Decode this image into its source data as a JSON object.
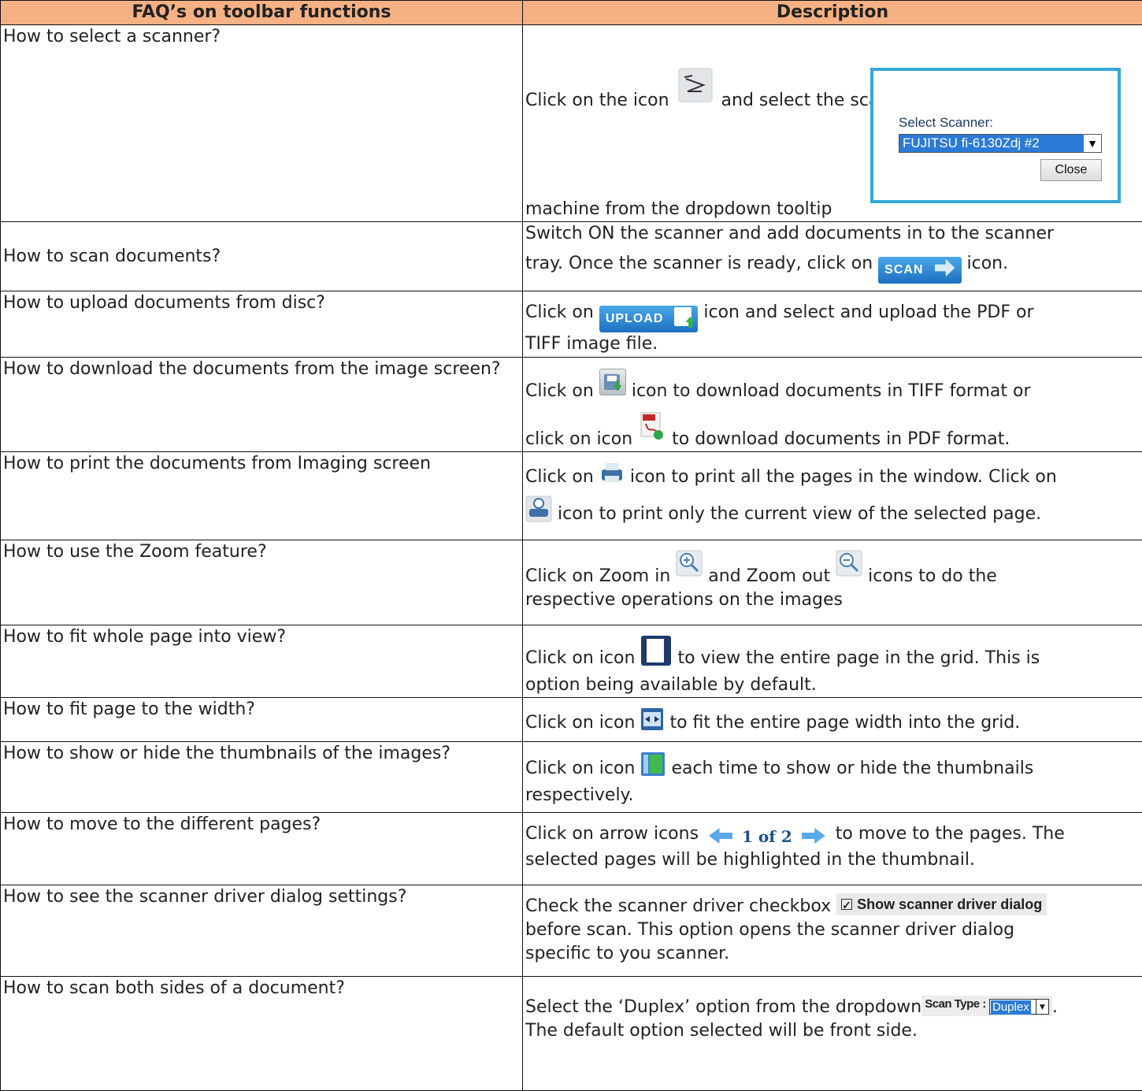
{
  "header": {
    "col1": "FAQ’s on toolbar functions",
    "col2": "Description"
  },
  "rows": [
    {
      "q": "How to select a scanner?",
      "d1": "Click on the icon",
      "d2": "and select the scanner connected to the",
      "d3": "machine from the dropdown tooltip"
    },
    {
      "q": "How to scan documents?",
      "d1": "Switch ON the scanner and add documents in to the scanner",
      "d2": "tray. Once the scanner is ready, click on",
      "d3": "icon."
    },
    {
      "q": "How to upload documents from disc?",
      "d1": "Click on",
      "d2": "icon and select and upload the PDF or",
      "d3": "TIFF image file."
    },
    {
      "q": "How to download the documents from the image screen?",
      "d1": "Click on",
      "d2": "icon to download documents in TIFF format or",
      "d3": "click on icon",
      "d4": "to download documents in PDF format."
    },
    {
      "q": "How to print the documents from Imaging screen",
      "d1": "Click on",
      "d2": "icon to print all the pages in the window. Click on",
      "d3": "icon to print only the current view of the selected page."
    },
    {
      "q": "How to use the Zoom feature?",
      "d1": "Click on Zoom in",
      "d2": "and Zoom out",
      "d3": "icons to do the",
      "d4": "respective operations on the images"
    },
    {
      "q": "How to fit whole page into view?",
      "d1": "Click on icon",
      "d2": "to view the entire page in the grid. This is",
      "d3": "option being available by default."
    },
    {
      "q": "How to fit page to the width?",
      "d1": "Click on icon",
      "d2": "to fit the entire page width into the grid."
    },
    {
      "q": "How to show or hide the thumbnails of the images?",
      "d1": "Click on icon",
      "d2": "each time to show or hide the thumbnails",
      "d3": "respectively."
    },
    {
      "q": "How to move to the different pages?",
      "d1": "Click on arrow icons",
      "d2": "to move to the pages. The",
      "d3": "selected pages will be highlighted in the thumbnail."
    },
    {
      "q": "How to see the scanner driver dialog settings?",
      "d1": " Check the scanner driver checkbox",
      "d2": "before scan. This option opens the scanner driver dialog",
      "d3": "specific to you scanner."
    },
    {
      "q": "How to scan both sides of a document?",
      "d1": "Select the ‘Duplex’ option from the dropdown",
      "d2": ".",
      "d3": "The default option selected will be front side."
    }
  ],
  "widgets": {
    "scan_btn": "SCAN",
    "upload_btn": "UPLOAD",
    "tooltip_label": "Select Scanner:",
    "tooltip_value": "FUJITSU fi-6130Zdj #2",
    "tooltip_close": "Close",
    "pager_text": "1 of 2",
    "checkbox_label": "Show scanner driver dialog",
    "scantype_label": "Scan Type :",
    "scantype_value": "Duplex"
  },
  "colors": {
    "header_bg": "#f5b183",
    "accent": "#37a8d4"
  }
}
